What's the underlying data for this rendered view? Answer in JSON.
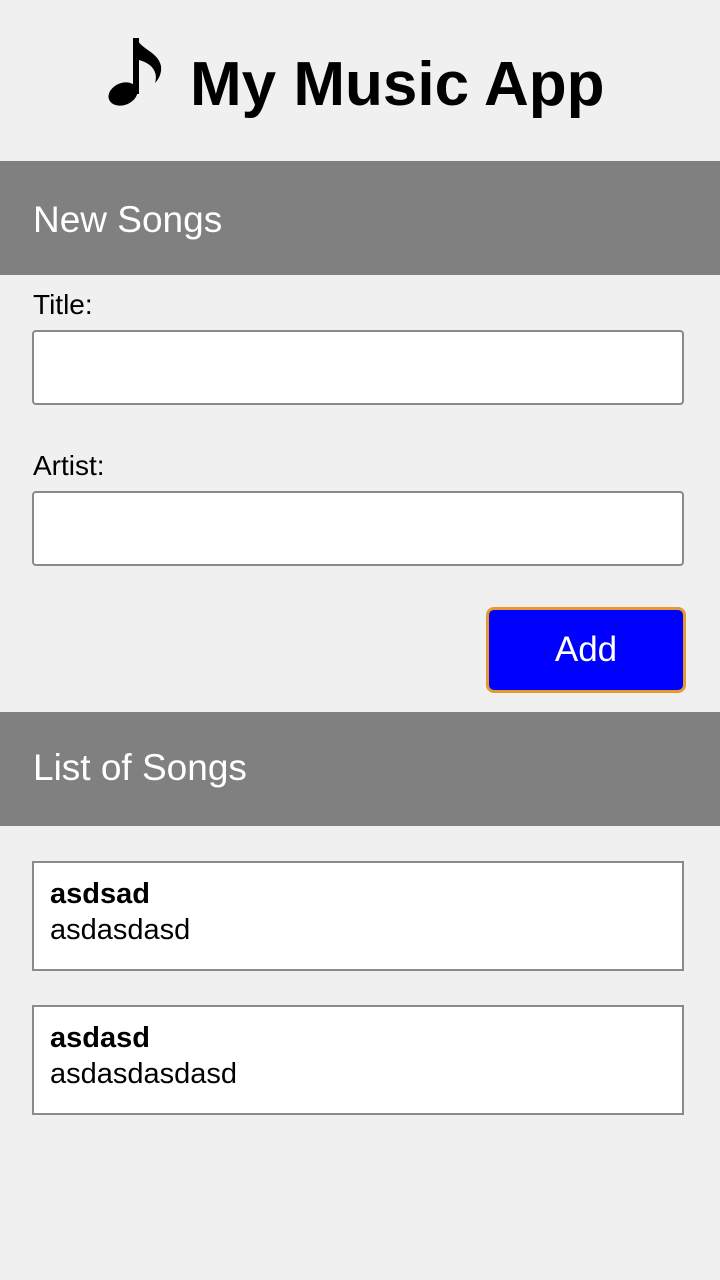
{
  "header": {
    "icon": "music-note-icon",
    "title": "My Music App"
  },
  "new_songs": {
    "heading": "New Songs",
    "title_label": "Title:",
    "title_value": "",
    "artist_label": "Artist:",
    "artist_value": "",
    "add_label": "Add"
  },
  "song_list": {
    "heading": "List of Songs",
    "songs": [
      {
        "title": "asdsad",
        "artist": "asdasdasd"
      },
      {
        "title": "asdasd",
        "artist": "asdasdasdasd"
      }
    ]
  },
  "colors": {
    "background": "#f0f0f0",
    "section_bar": "#808080",
    "add_button": "#0000ff",
    "add_button_border": "#e69a2e"
  }
}
